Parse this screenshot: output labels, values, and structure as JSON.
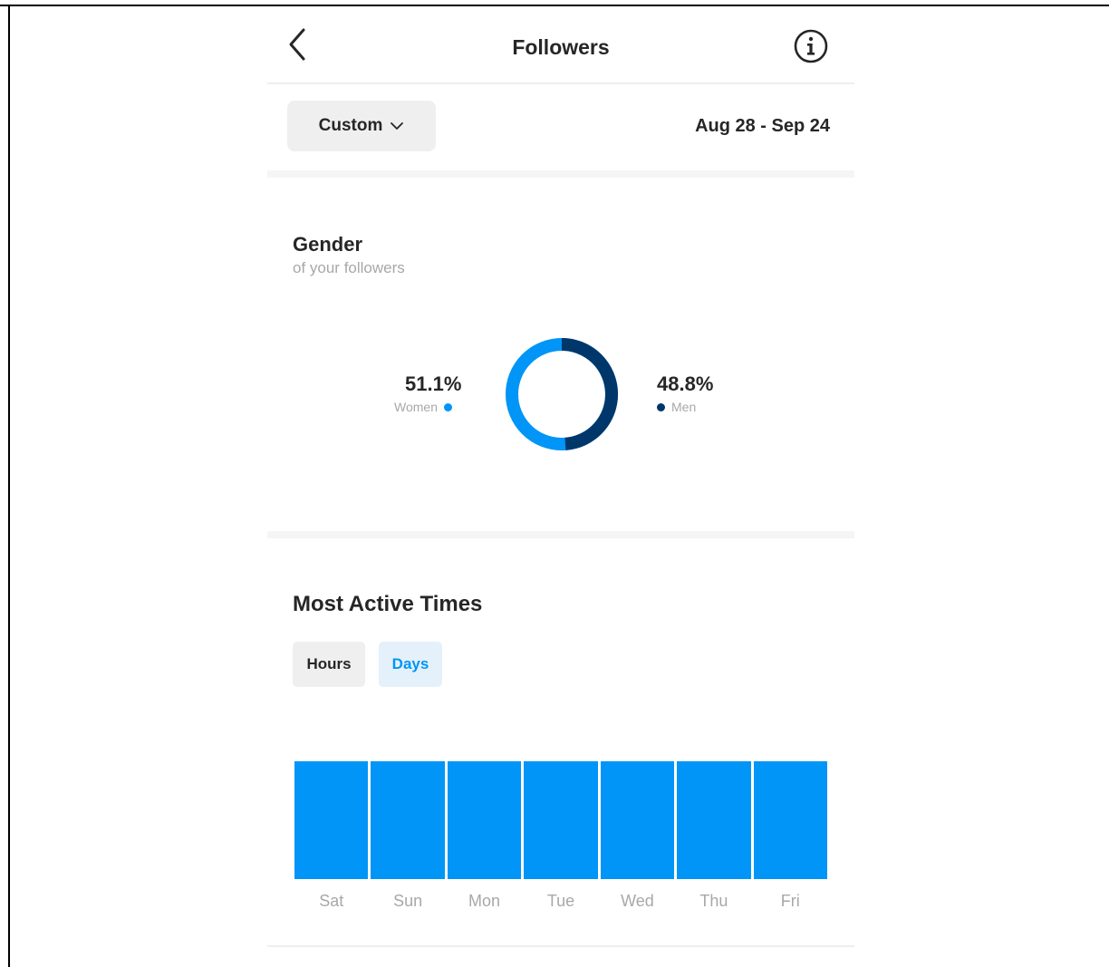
{
  "header": {
    "title": "Followers",
    "back_icon": "chevron-left-icon",
    "info_icon": "info-circle-icon"
  },
  "filter": {
    "range_label": "Custom",
    "range_icon": "chevron-down-icon",
    "date_range": "Aug 28 - Sep 24"
  },
  "gender": {
    "title": "Gender",
    "subtitle": "of your followers",
    "women": {
      "percent": "51.1%",
      "label": "Women",
      "color": "#0095f6"
    },
    "men": {
      "percent": "48.8%",
      "label": "Men",
      "color": "#00376b"
    }
  },
  "active_times": {
    "title": "Most Active Times",
    "tabs": [
      {
        "label": "Hours",
        "selected": false
      },
      {
        "label": "Days",
        "selected": true
      }
    ]
  },
  "colors": {
    "accent": "#0095f6",
    "dark_accent": "#00376b",
    "muted_text": "#a8a8a8"
  },
  "chart_data": [
    {
      "type": "pie",
      "categories": [
        "Women",
        "Men"
      ],
      "values": [
        51.1,
        48.8
      ]
    },
    {
      "type": "bar",
      "categories": [
        "Sat",
        "Sun",
        "Mon",
        "Tue",
        "Wed",
        "Thu",
        "Fri"
      ],
      "values": [
        1,
        1,
        1,
        1,
        1,
        1,
        1
      ]
    }
  ]
}
